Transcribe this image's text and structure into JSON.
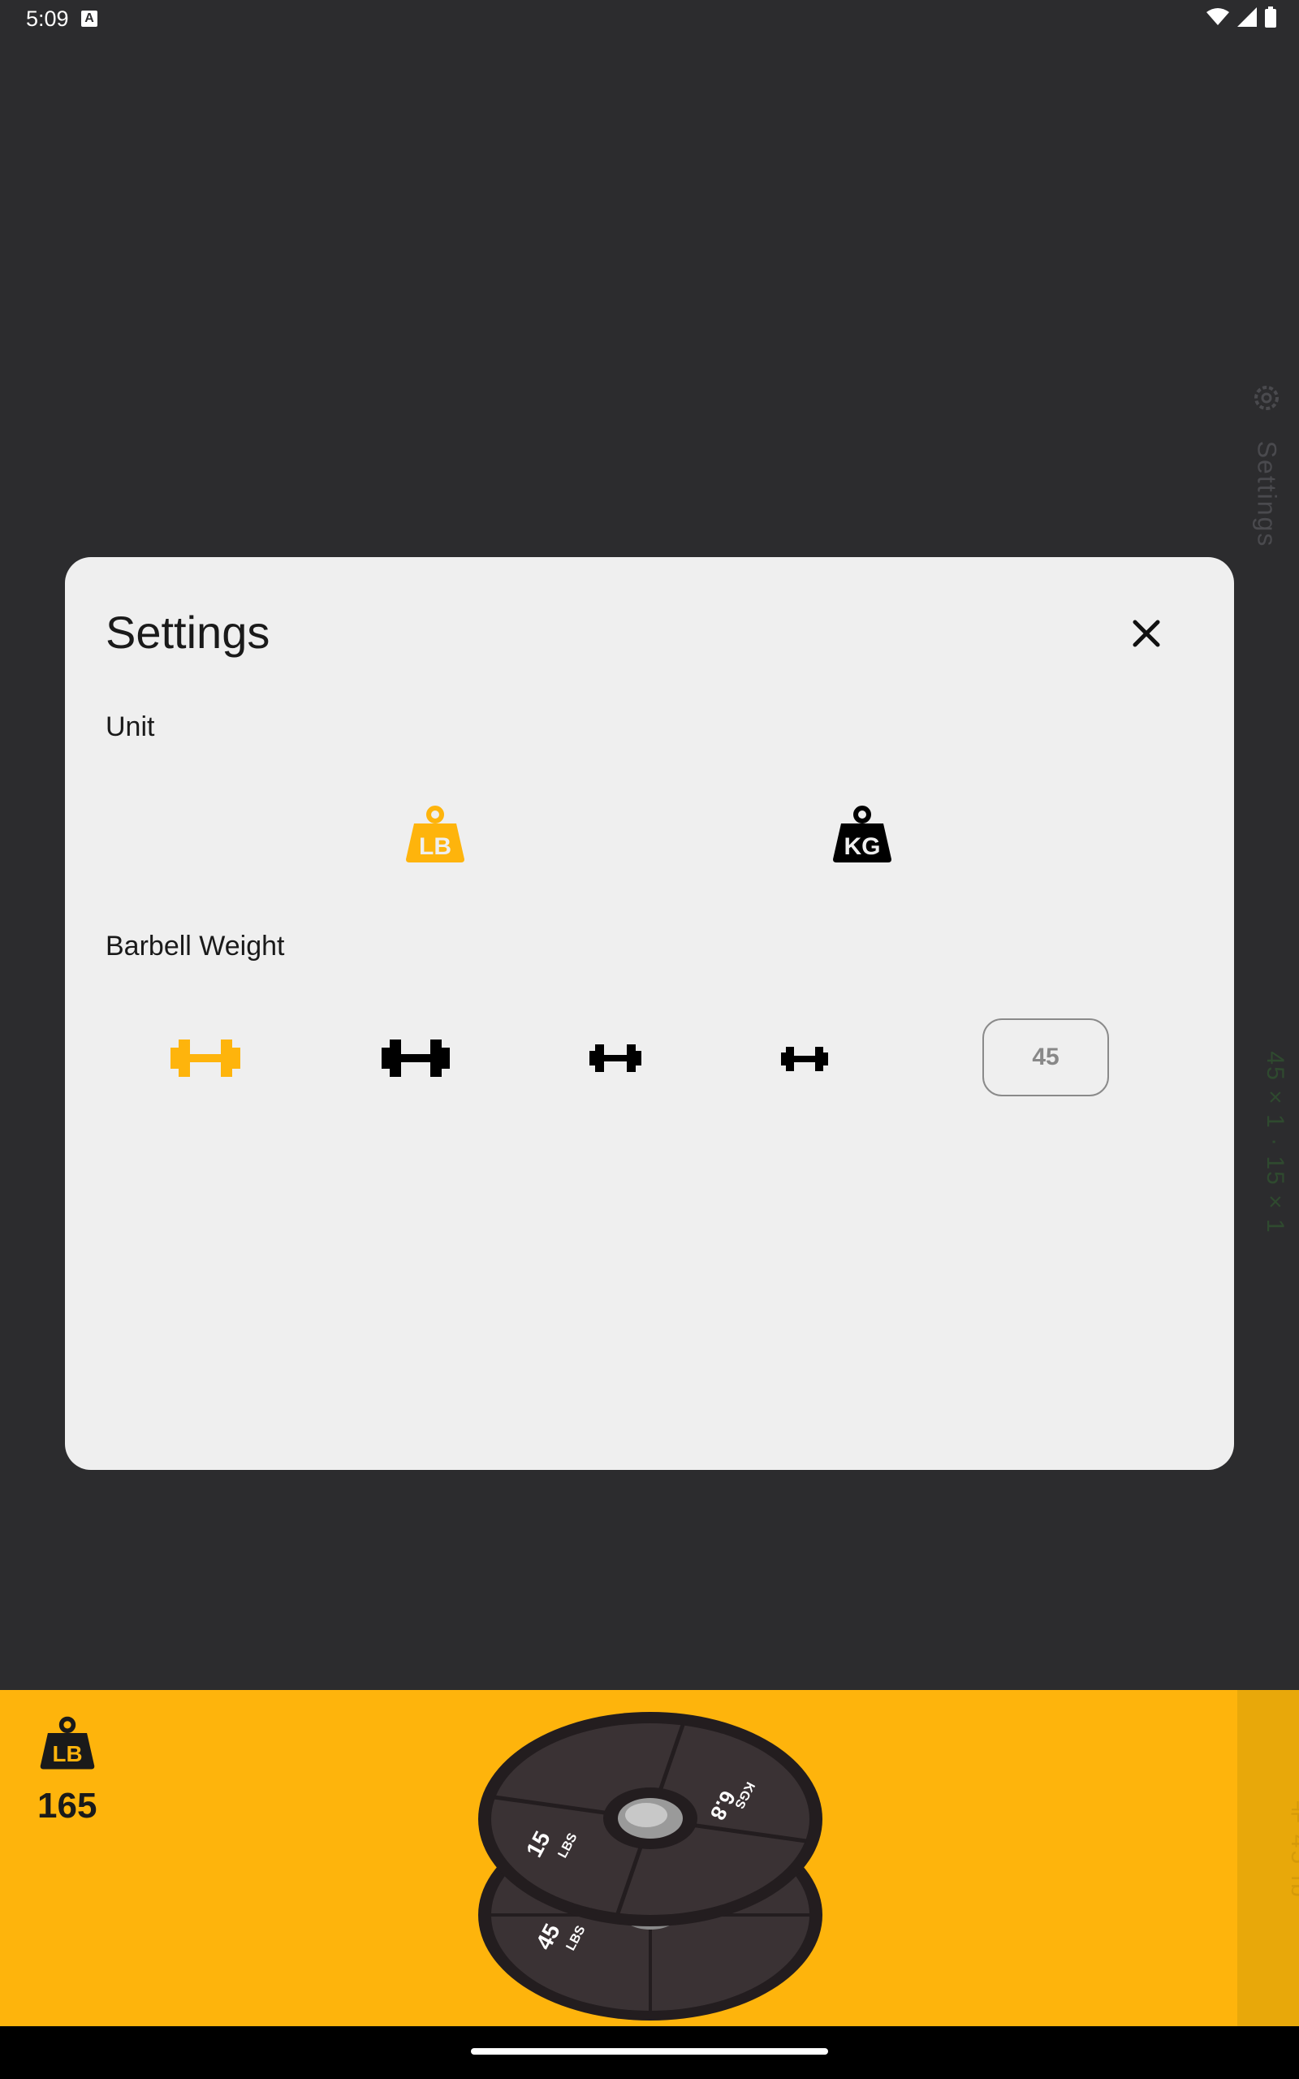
{
  "status_bar": {
    "time": "5:09",
    "notification_badge": "A"
  },
  "background": {
    "settings_label": "Settings",
    "plate_summary": "45 × 1 · 15 × 1",
    "strip_label": "⟛ 45 lb"
  },
  "dialog": {
    "title": "Settings",
    "unit_section": "Unit",
    "unit_options": [
      {
        "name": "lb",
        "label": "LB",
        "selected": true,
        "color": "#feb40c"
      },
      {
        "name": "kg",
        "label": "KG",
        "selected": false,
        "color": "#000000"
      }
    ],
    "barbell_section": "Barbell Weight",
    "barbell_options": [
      {
        "size": "large",
        "selected": true,
        "color": "#feb40c"
      },
      {
        "size": "large",
        "selected": false,
        "color": "#000000"
      },
      {
        "size": "medium",
        "selected": false,
        "color": "#000000"
      },
      {
        "size": "small",
        "selected": false,
        "color": "#000000"
      }
    ],
    "custom_weight_value": "45"
  },
  "bottom_panel": {
    "unit_icon_label": "LB",
    "total": "165",
    "plates": [
      {
        "lbs_label": "45",
        "unit_lbs": "LBS"
      },
      {
        "lbs_label": "15",
        "unit_lbs": "LBS",
        "kg_label": "6.8",
        "unit_kg": "KGS"
      }
    ]
  },
  "colors": {
    "accent": "#feb40c",
    "background": "#2c2c2e",
    "dialog": "#efefef",
    "plate": "#3a3234"
  }
}
